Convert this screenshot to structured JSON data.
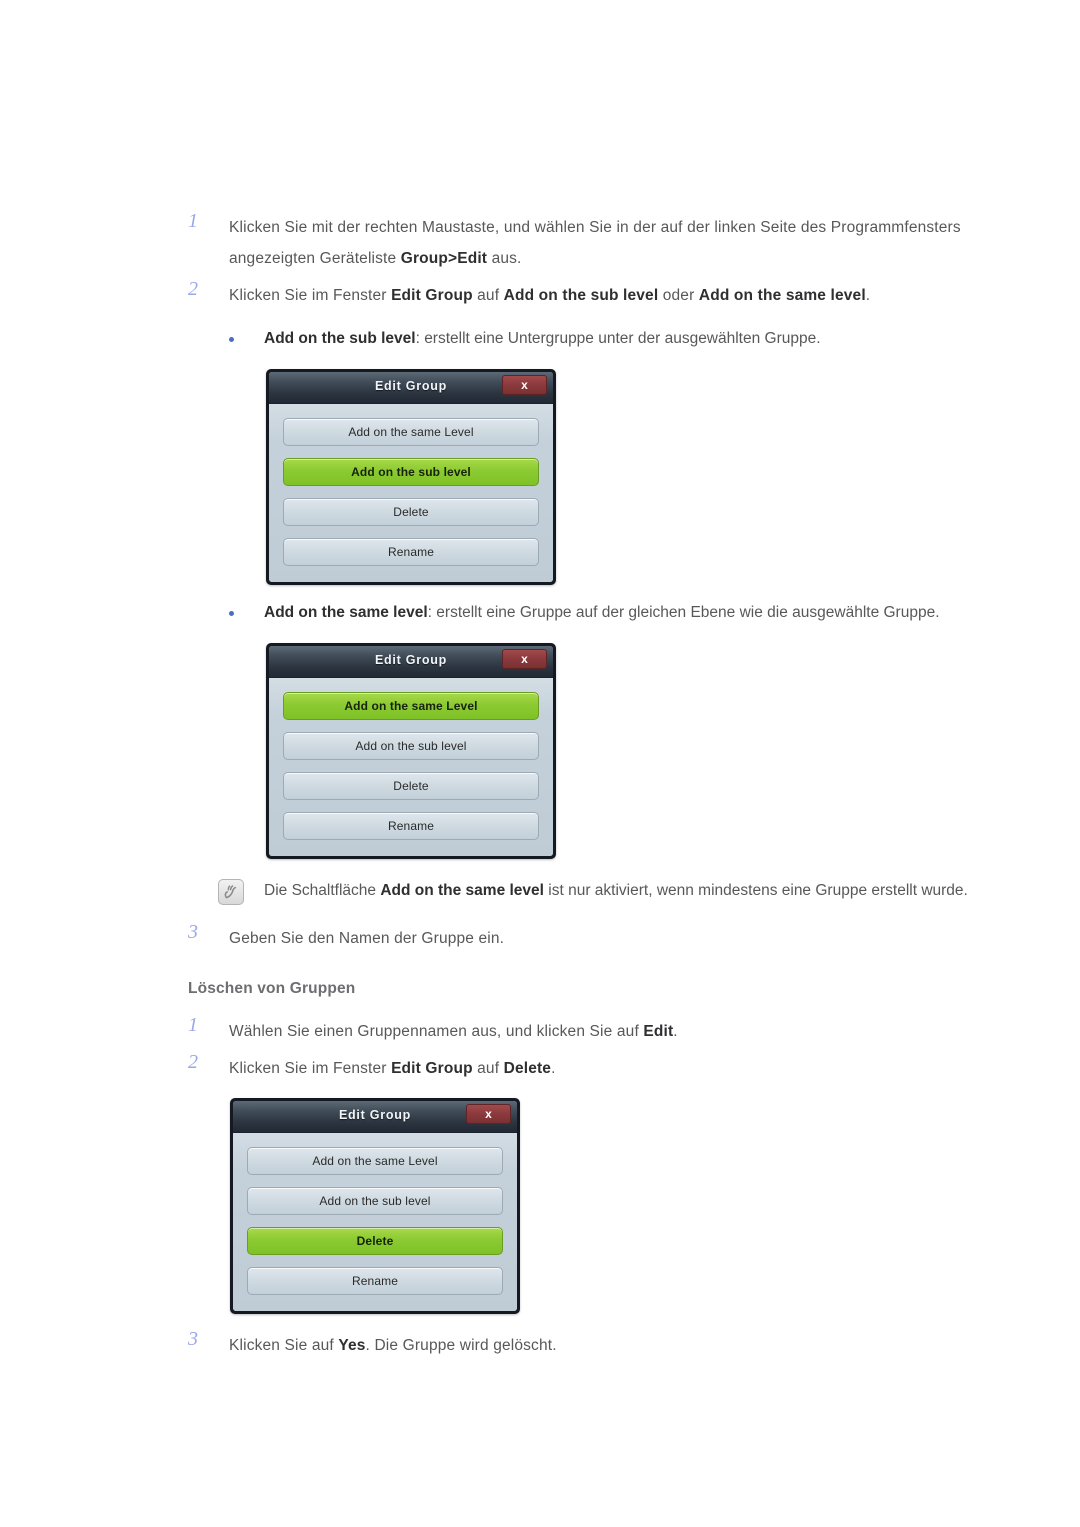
{
  "document": {
    "language": "de"
  },
  "section_one": {
    "steps": [
      {
        "number": "1",
        "parts": [
          {
            "t": "Klicken Sie mit der rechten Maustaste, und wählen Sie in der auf der linken Seite des Programmfensters angezeigten Geräteliste ",
            "b": false
          },
          {
            "t": "Group>Edit",
            "b": true
          },
          {
            "t": " aus.",
            "b": false
          }
        ]
      },
      {
        "number": "2",
        "parts": [
          {
            "t": "Klicken Sie im Fenster ",
            "b": false
          },
          {
            "t": "Edit Group",
            "b": true
          },
          {
            "t": " auf ",
            "b": false
          },
          {
            "t": "Add on the sub level",
            "b": true
          },
          {
            "t": " oder ",
            "b": false
          },
          {
            "t": "Add on the same level",
            "b": true
          },
          {
            "t": ".",
            "b": false
          }
        ]
      }
    ],
    "bullet_sub_level": [
      {
        "t": "Add on the sub level",
        "b": true
      },
      {
        "t": ": erstellt eine Untergruppe unter der ausgewählten Gruppe.",
        "b": false
      }
    ],
    "bullet_same_level": [
      {
        "t": "Add on the same level",
        "b": true
      },
      {
        "t": ": erstellt eine Gruppe auf der gleichen Ebene wie die ausgewählte Gruppe.",
        "b": false
      }
    ],
    "note": [
      {
        "t": "Die Schaltfläche ",
        "b": false
      },
      {
        "t": "Add on the same level",
        "b": true
      },
      {
        "t": " ist nur aktiviert, wenn mindestens eine Gruppe erstellt wurde.",
        "b": false
      }
    ],
    "step_three": {
      "number": "3",
      "parts": [
        {
          "t": "Geben Sie den Namen der Gruppe ein.",
          "b": false
        }
      ]
    }
  },
  "section_two": {
    "heading": "Löschen von Gruppen",
    "steps": [
      {
        "number": "1",
        "parts": [
          {
            "t": "Wählen Sie einen Gruppennamen aus, und klicken Sie auf ",
            "b": false
          },
          {
            "t": "Edit",
            "b": true
          },
          {
            "t": ".",
            "b": false
          }
        ]
      },
      {
        "number": "2",
        "parts": [
          {
            "t": "Klicken Sie im Fenster ",
            "b": false
          },
          {
            "t": "Edit Group",
            "b": true
          },
          {
            "t": " auf ",
            "b": false
          },
          {
            "t": "Delete",
            "b": true
          },
          {
            "t": ".",
            "b": false
          }
        ]
      }
    ],
    "step_three": {
      "number": "3",
      "parts": [
        {
          "t": "Klicken Sie auf ",
          "b": false
        },
        {
          "t": "Yes",
          "b": true
        },
        {
          "t": ". Die Gruppe wird gelöscht.",
          "b": false
        }
      ]
    }
  },
  "dialogs": [
    {
      "id": "dialog-sub-level",
      "title": "Edit Group",
      "close_label": "x",
      "buttons": [
        {
          "label": "Add on the same Level",
          "active": false
        },
        {
          "label": "Add on the sub level",
          "active": true
        },
        {
          "label": "Delete",
          "active": false
        },
        {
          "label": "Rename",
          "active": false
        }
      ]
    },
    {
      "id": "dialog-same-level",
      "title": "Edit Group",
      "close_label": "x",
      "buttons": [
        {
          "label": "Add on the same Level",
          "active": true
        },
        {
          "label": "Add on the sub level",
          "active": false
        },
        {
          "label": "Delete",
          "active": false
        },
        {
          "label": "Rename",
          "active": false
        }
      ]
    },
    {
      "id": "dialog-delete",
      "title": "Edit Group",
      "close_label": "x",
      "buttons": [
        {
          "label": "Add on the same Level",
          "active": false
        },
        {
          "label": "Add on the sub level",
          "active": false
        },
        {
          "label": "Delete",
          "active": true
        },
        {
          "label": "Rename",
          "active": false
        }
      ]
    }
  ],
  "colors": {
    "step_number": "#9aa8e8",
    "bullet": "#4a6fc4",
    "body_text": "#58585a",
    "bold_text": "#2f2f31",
    "heading": "#6d6e71",
    "dialog_accent_green": "#8dcb33",
    "dialog_close_red": "#8d3b3e",
    "dialog_body": "#c4d0da",
    "dialog_frame": "#151a22"
  }
}
